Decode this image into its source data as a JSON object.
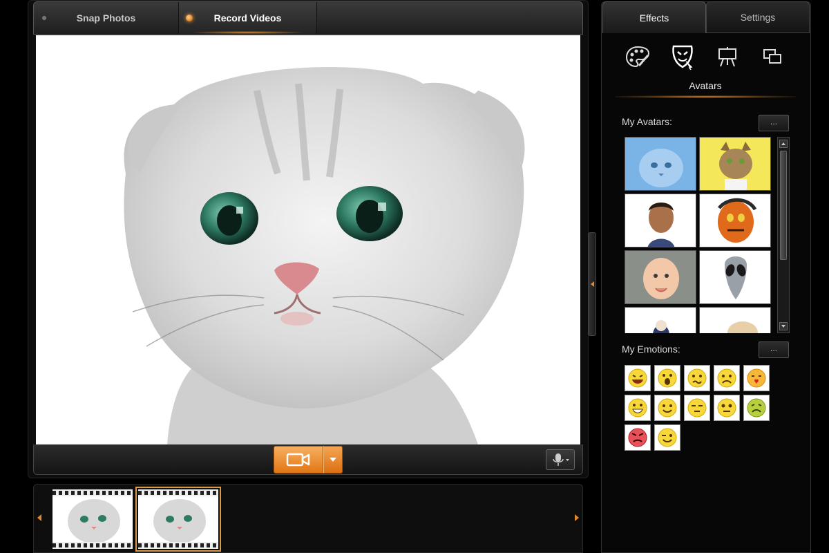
{
  "main": {
    "tabs": [
      {
        "label": "Snap Photos",
        "active": false
      },
      {
        "label": "Record Videos",
        "active": true
      }
    ],
    "preview": {
      "subject": "kitten"
    },
    "controls": {
      "record_icon": "video-camera-icon",
      "dropdown_icon": "chevron-down-icon",
      "mic_icon": "microphone-icon"
    }
  },
  "filmstrip": {
    "items": [
      {
        "subject": "kitten",
        "selected": false
      },
      {
        "subject": "kitten",
        "selected": true
      }
    ]
  },
  "side": {
    "tabs": [
      {
        "label": "Effects",
        "active": true
      },
      {
        "label": "Settings",
        "active": false
      }
    ],
    "effect_icons": [
      "palette-icon",
      "avatar-mask-icon",
      "scene-easel-icon",
      "frames-icon"
    ],
    "active_effect": "Avatars",
    "avatars_label": "My Avatars:",
    "emotions_label": "My Emotions:",
    "more_label": "...",
    "avatars": [
      {
        "name": "blue-kitten"
      },
      {
        "name": "tabby-cat"
      },
      {
        "name": "cartoon-man"
      },
      {
        "name": "monster"
      },
      {
        "name": "baby"
      },
      {
        "name": "alien"
      },
      {
        "name": "character-blue"
      },
      {
        "name": "puppy"
      }
    ],
    "emotions": [
      {
        "name": "laugh"
      },
      {
        "name": "surprised"
      },
      {
        "name": "confused"
      },
      {
        "name": "sad"
      },
      {
        "name": "kiss"
      },
      {
        "name": "grin"
      },
      {
        "name": "smile"
      },
      {
        "name": "sleepy"
      },
      {
        "name": "worried"
      },
      {
        "name": "sick"
      },
      {
        "name": "angry"
      },
      {
        "name": "wink"
      }
    ]
  },
  "colors": {
    "accent": "#e27614",
    "background": "#000000"
  }
}
